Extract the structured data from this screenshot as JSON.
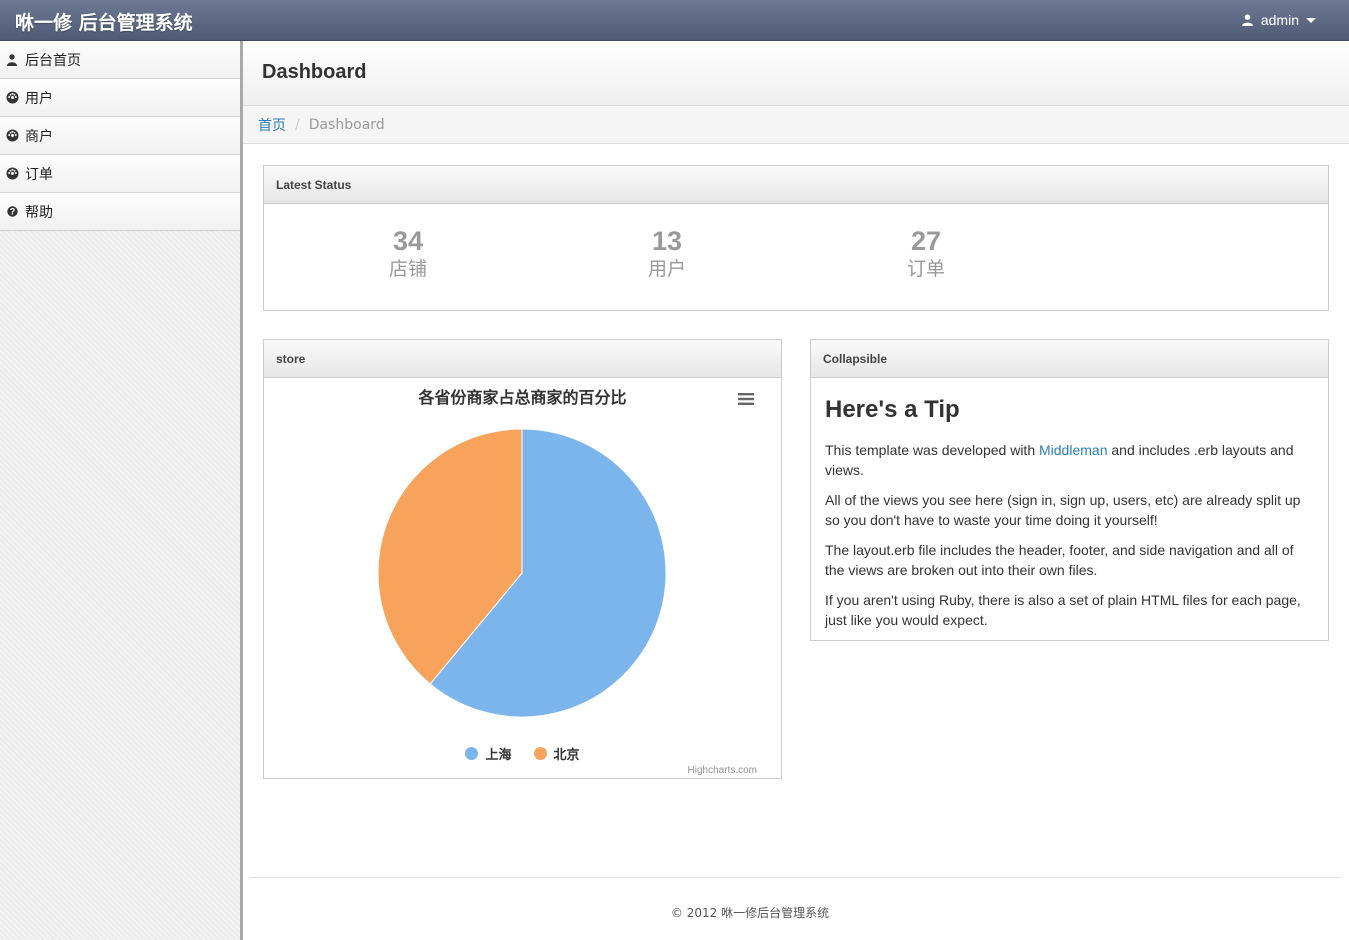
{
  "navbar": {
    "brand": "咻一修 后台管理系统",
    "user": "admin"
  },
  "sidebar": {
    "items": [
      {
        "label": "后台首页",
        "icon": "user-icon"
      },
      {
        "label": "用户",
        "icon": "dashboard-icon"
      },
      {
        "label": "商户",
        "icon": "dashboard-icon"
      },
      {
        "label": "订单",
        "icon": "dashboard-icon"
      },
      {
        "label": "帮助",
        "icon": "question-icon"
      }
    ]
  },
  "page": {
    "title": "Dashboard"
  },
  "breadcrumb": {
    "home": "首页",
    "current": "Dashboard"
  },
  "latest_status": {
    "header": "Latest Status",
    "stats": [
      {
        "value": "34",
        "label": "店铺"
      },
      {
        "value": "13",
        "label": "用户"
      },
      {
        "value": "27",
        "label": "订单"
      }
    ]
  },
  "store_block": {
    "header": "store",
    "credits": "Highcharts.com"
  },
  "chart_data": {
    "type": "pie",
    "title": "各省份商家占总商家的百分比",
    "categories": [
      "上海",
      "北京"
    ],
    "values": [
      61,
      39
    ],
    "colors": [
      "#7cb5ec",
      "#f7a35c"
    ],
    "legend": "bottom-center"
  },
  "tip_block": {
    "header": "Collapsible",
    "title": "Here's a Tip",
    "p1_before": "This template was developed with ",
    "p1_link": "Middleman",
    "p1_after": " and includes .erb layouts and views.",
    "p2": "All of the views you see here (sign in, sign up, users, etc) are already split up so you don't have to waste your time doing it yourself!",
    "p3": "The layout.erb file includes the header, footer, and side navigation and all of the views are broken out into their own files.",
    "p4": "If you aren't using Ruby, there is also a set of plain HTML files for each page, just like you would expect."
  },
  "footer": {
    "text": "© 2012 咻一修后台管理系统"
  }
}
